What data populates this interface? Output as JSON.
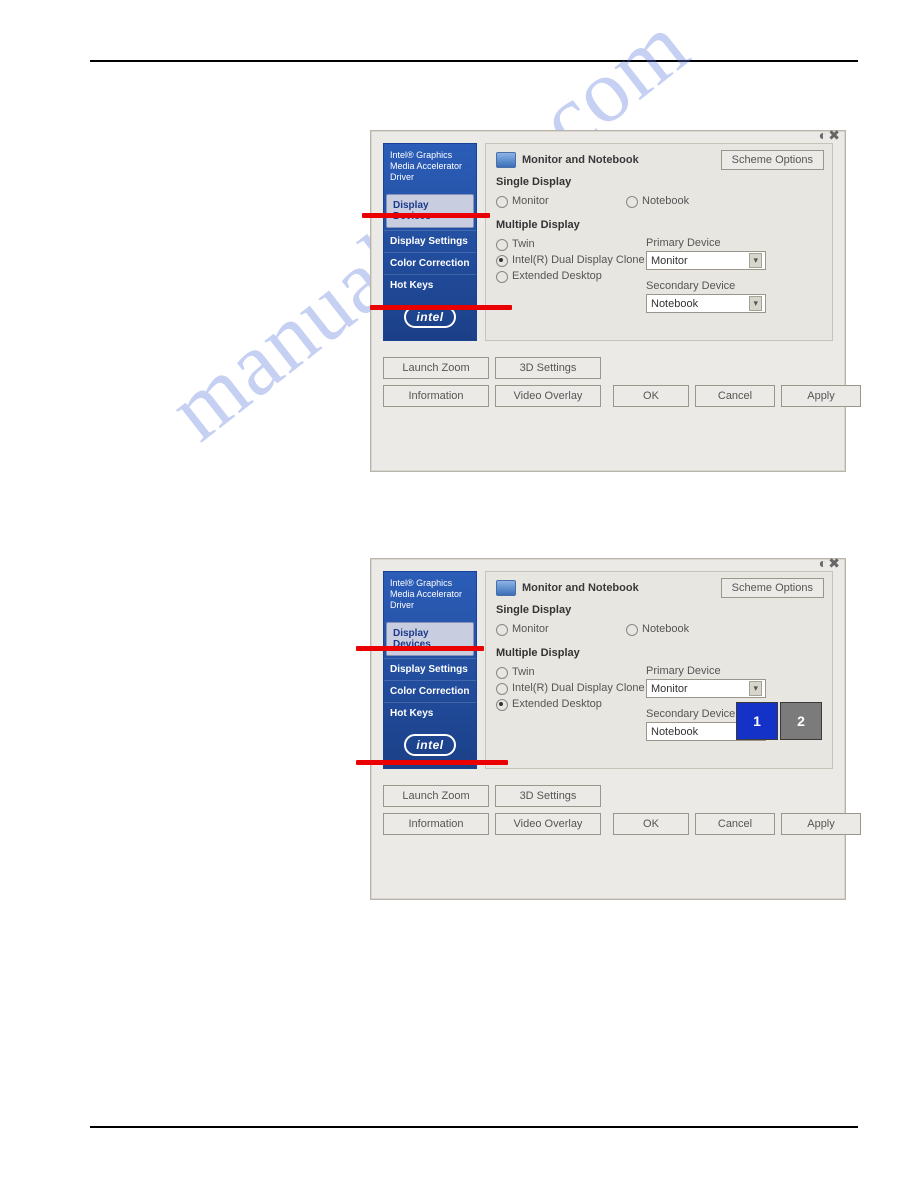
{
  "watermark_text": "manualslive.com",
  "dialog1": {
    "sidebar_title": "Intel®\nGraphics Media\nAccelerator Driver",
    "nav": [
      "Display Devices",
      "Display Settings",
      "Color Correction",
      "Hot Keys"
    ],
    "selected_nav_index": 0,
    "logo_text": "intel",
    "header_title": "Monitor and Notebook",
    "scheme_button": "Scheme Options",
    "single_label": "Single Display",
    "single_options": [
      "Monitor",
      "Notebook"
    ],
    "multiple_label": "Multiple Display",
    "multiple_options": [
      "Twin",
      "Intel(R) Dual Display Clone",
      "Extended Desktop"
    ],
    "multiple_selected_index": 1,
    "primary_label": "Primary Device",
    "primary_value": "Monitor",
    "secondary_label": "Secondary Device",
    "secondary_value": "Notebook",
    "buttons": {
      "launch_zoom": "Launch Zoom",
      "information": "Information",
      "threed": "3D Settings",
      "video_overlay": "Video Overlay",
      "ok": "OK",
      "cancel": "Cancel",
      "apply": "Apply"
    }
  },
  "dialog2": {
    "sidebar_title": "Intel®\nGraphics Media\nAccelerator Driver",
    "nav": [
      "Display Devices",
      "Display Settings",
      "Color Correction",
      "Hot Keys"
    ],
    "selected_nav_index": 0,
    "logo_text": "intel",
    "header_title": "Monitor and Notebook",
    "scheme_button": "Scheme Options",
    "single_label": "Single Display",
    "single_options": [
      "Monitor",
      "Notebook"
    ],
    "multiple_label": "Multiple Display",
    "multiple_options": [
      "Twin",
      "Intel(R) Dual Display Clone",
      "Extended Desktop"
    ],
    "multiple_selected_index": 2,
    "primary_label": "Primary Device",
    "primary_value": "Monitor",
    "secondary_label": "Secondary Device",
    "secondary_value": "Notebook",
    "thumbs": [
      "1",
      "2"
    ],
    "buttons": {
      "launch_zoom": "Launch Zoom",
      "information": "Information",
      "threed": "3D Settings",
      "video_overlay": "Video Overlay",
      "ok": "OK",
      "cancel": "Cancel",
      "apply": "Apply"
    }
  }
}
